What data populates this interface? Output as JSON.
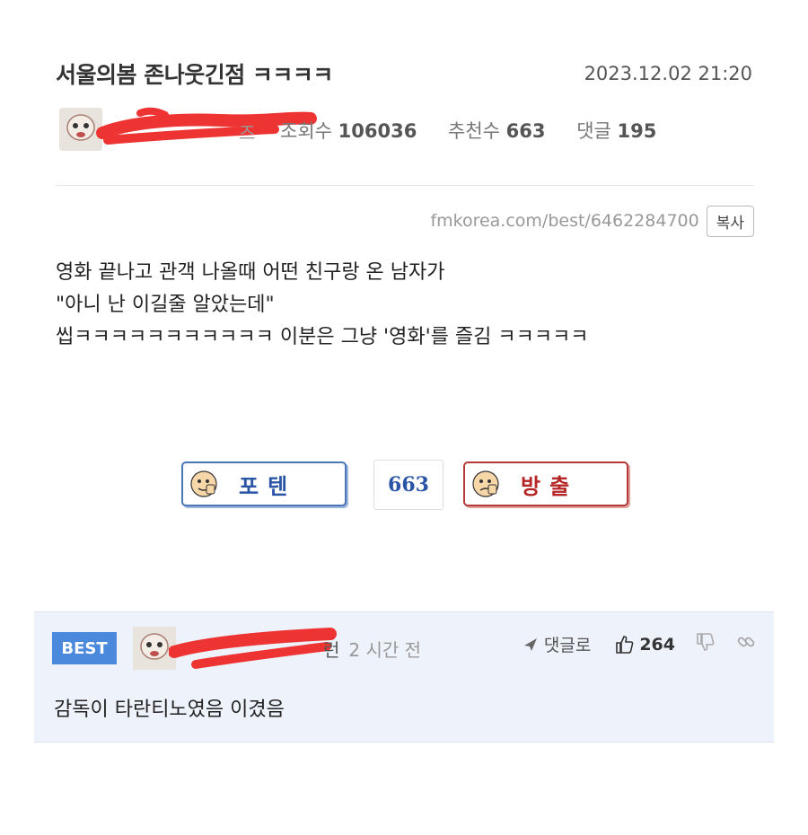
{
  "post": {
    "title": "서울의봄 존나웃긴점 ㅋㅋㅋㅋ",
    "date": "2023.12.02 21:20",
    "author_suffix": "즈",
    "stats": {
      "views_label": "조회수",
      "views": "106036",
      "recommend_label": "추천수",
      "recommend": "663",
      "comments_label": "댓글",
      "comments": "195"
    },
    "url": "fmkorea.com/best/6462284700",
    "copy_label": "복사",
    "body_lines": [
      "영화 끝나고 관객 나올때 어떤 친구랑 온 남자가",
      "\"아니 난 이길줄 알았는데\"",
      "씹ㅋㅋㅋㅋㅋㅋㅋㅋㅋㅋㅋ 이분은 그냥 '영화'를 즐김 ㅋㅋㅋㅋㅋ"
    ]
  },
  "vote": {
    "up_label": "포텐",
    "count": "663",
    "down_label": "방출"
  },
  "comment": {
    "badge": "BEST",
    "author_suffix": "런",
    "time": "2 시간 전",
    "reply_label": "댓글로",
    "likes": "264",
    "text": "감독이 타란티노였음 이겼음"
  },
  "colors": {
    "accent_blue": "#4a89dc",
    "vote_up": "#2a55a6",
    "vote_down": "#b52525",
    "comment_bg": "#eef2fb"
  }
}
